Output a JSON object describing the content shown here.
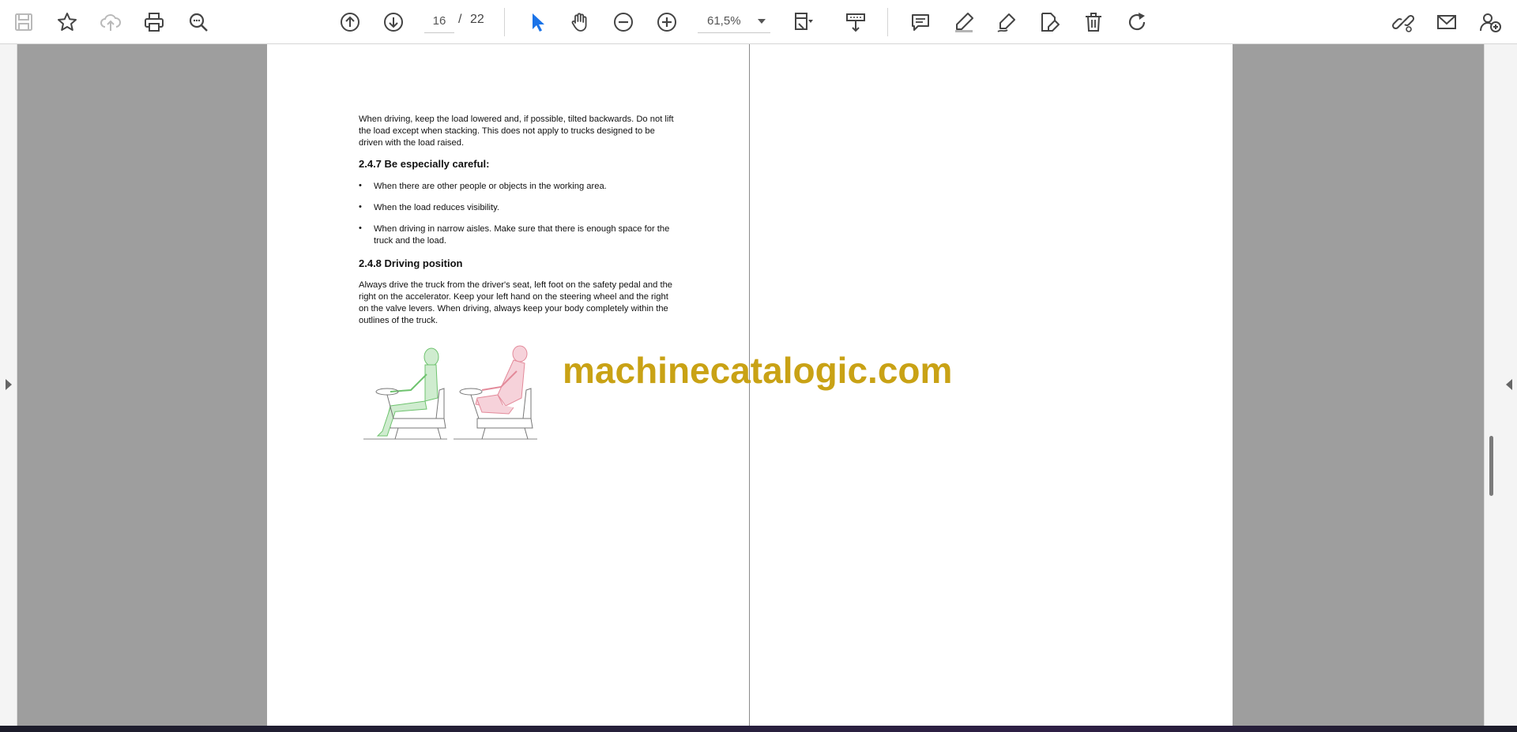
{
  "toolbar": {
    "page_number": "16",
    "page_separator": "/",
    "page_total": "22",
    "zoom": "61,5%",
    "icons_left": [
      "save-icon",
      "bookmark-star-icon",
      "cloud-upload-icon",
      "print-icon",
      "zoom-search-icon"
    ],
    "icons_nav": [
      "page-up-icon",
      "page-down-icon"
    ],
    "icons_tools": [
      "select-cursor-icon",
      "hand-pan-icon",
      "zoom-out-icon",
      "zoom-in-icon"
    ],
    "icons_view": [
      "fit-page-icon",
      "scroll-mode-icon"
    ],
    "icons_annotate": [
      "comment-icon",
      "highlight-pen-icon",
      "sign-pen-icon",
      "edit-document-icon",
      "delete-trash-icon",
      "rotate-icon"
    ],
    "icons_right": [
      "share-link-icon",
      "email-icon",
      "add-user-icon"
    ],
    "accent_color": "#1a73e8"
  },
  "document": {
    "intro_paragraph": "When driving, keep the load lowered and, if possible, tilted backwards. Do not lift the load except when stacking. This does not apply to trucks designed to be driven with the load raised.",
    "section_247_title": "2.4.7 Be especially careful:",
    "bullet_symbol": "•",
    "bullets": [
      "When there are other people or objects in the working area.",
      "When the load reduces visibility.",
      "When driving in narrow aisles. Make sure that there is enough space for the truck and the load."
    ],
    "section_248_title": "2.4.8 Driving position",
    "driving_paragraph": "Always drive the truck from the driver's seat, left foot on the safety pedal and the right on the accelerator. Keep your left hand on the steering wheel and the right on the valve levers. When driving, always keep your body completely within the outlines of the truck.",
    "figure_colors": {
      "correct": "#6fc36f",
      "incorrect": "#e38a9a"
    }
  },
  "watermark": {
    "text": "machinecatalogic.com",
    "color": "#c9a215"
  }
}
